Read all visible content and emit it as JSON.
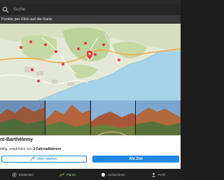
{
  "search": {
    "placeholder": "Suche"
  },
  "hint": {
    "text": "Punkte per Klick auf die Karte"
  },
  "map": {
    "colors": {
      "land": "#e4e8d6",
      "forest": "#b9d39a",
      "sea": "#a7d3e8",
      "road": "#ffffff",
      "highway": "#f0a93a",
      "pin": "#e53935"
    },
    "icons": [
      "map-pin-icon",
      "poi-marker-icon"
    ]
  },
  "photos": {
    "count": 4
  },
  "place": {
    "title": "nt-Barthélemy",
    "subtitle_prefix": "fällig, empfohlen von",
    "subtitle_count": "3 Fahrradfahrern"
  },
  "actions": {
    "start_label": "Hier starten",
    "destination_label": "Als Ziel"
  },
  "nav": {
    "items": [
      {
        "label": "Entdecken",
        "icon": "compass-icon",
        "active": false
      },
      {
        "label": "Planen",
        "icon": "route-icon",
        "active": true
      },
      {
        "label": "Aufzeichnen",
        "icon": "record-icon",
        "active": false
      },
      {
        "label": "Profil",
        "icon": "profile-icon",
        "active": false
      }
    ]
  }
}
